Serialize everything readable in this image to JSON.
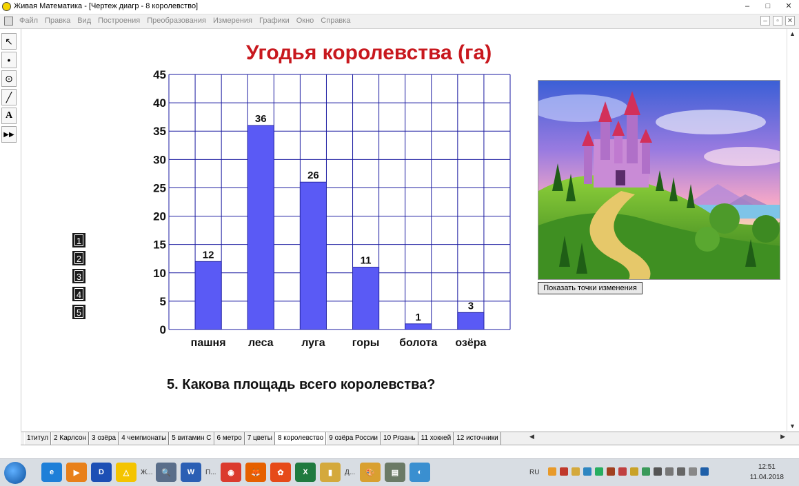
{
  "window": {
    "title": "Живая Математика - [Чертеж диагр - 8 королевство]",
    "controls": [
      "–",
      "□",
      "✕"
    ]
  },
  "menu": {
    "items": [
      "Файл",
      "Правка",
      "Вид",
      "Построения",
      "Преобразования",
      "Измерения",
      "Графики",
      "Окно",
      "Справка"
    ],
    "mdi_controls": [
      "–",
      "▫",
      "✕"
    ]
  },
  "toolbar": {
    "tools": [
      {
        "name": "arrow-tool-icon",
        "glyph": "↖"
      },
      {
        "name": "point-tool-icon",
        "glyph": "•"
      },
      {
        "name": "compass-tool-icon",
        "glyph": "⊙"
      },
      {
        "name": "line-tool-icon",
        "glyph": "╱"
      },
      {
        "name": "text-tool-icon",
        "glyph": "A"
      },
      {
        "name": "custom-tool-icon",
        "glyph": "▶▶"
      }
    ]
  },
  "document": {
    "nav_buttons": [
      "1",
      "2",
      "3",
      "4",
      "5"
    ],
    "question": "5. Какова площадь всего королевства?",
    "show_button_label": "Показать точки изменения"
  },
  "chart_data": {
    "type": "bar",
    "title": "Угодья королевства (га)",
    "categories": [
      "пашня",
      "леса",
      "луга",
      "горы",
      "болота",
      "озёра"
    ],
    "values": [
      12,
      36,
      26,
      11,
      1,
      3
    ],
    "ylim": [
      0,
      45
    ],
    "yticks": [
      0,
      5,
      10,
      15,
      20,
      25,
      30,
      35,
      40,
      45
    ],
    "xlabel": "",
    "ylabel": "",
    "grid": true,
    "colors": {
      "bar": "#5a5af5",
      "grid": "#1a1aa0",
      "title": "#c8181e"
    }
  },
  "pages": {
    "tabs": [
      "1титул",
      "2 Карлсон",
      "3 озёра",
      "4 чемпионаты",
      "5 витамин С",
      "6 метро",
      "7 цветы",
      "8 королевство",
      "9 озёра России",
      "10 Рязань",
      "11 хоккей",
      "12 источники"
    ],
    "active_index": 7
  },
  "taskbar": {
    "apps": [
      {
        "name": "ie-taskbar-icon",
        "color": "#1e7fd8",
        "label": "e"
      },
      {
        "name": "media-taskbar-icon",
        "color": "#e8801a",
        "label": "▶"
      },
      {
        "name": "d-app-taskbar-icon",
        "color": "#1c4fb5",
        "label": "D"
      },
      {
        "name": "sketchpad-taskbar-icon",
        "color": "#f4c400",
        "label": "△",
        "text": "Ж..."
      },
      {
        "name": "magnifier-taskbar-icon",
        "color": "#5a6e8a",
        "label": "🔍"
      },
      {
        "name": "word-taskbar-icon",
        "color": "#2b5fb4",
        "label": "W",
        "text": "П..."
      },
      {
        "name": "chrome-taskbar-icon",
        "color": "#db3b2e",
        "label": "◉"
      },
      {
        "name": "firefox-taskbar-icon",
        "color": "#e66000",
        "label": "🦊"
      },
      {
        "name": "reel-taskbar-icon",
        "color": "#e64a19",
        "label": "✿"
      },
      {
        "name": "excel-taskbar-icon",
        "color": "#1f7a3f",
        "label": "X"
      },
      {
        "name": "folder-taskbar-icon",
        "color": "#d4a93c",
        "label": "▮",
        "text": "Д..."
      },
      {
        "name": "paint-taskbar-icon",
        "color": "#d9a030",
        "label": "🎨"
      },
      {
        "name": "scanner-taskbar-icon",
        "color": "#6b7a66",
        "label": "▤"
      },
      {
        "name": "network-taskbar-icon",
        "color": "#3a8fd0",
        "label": "◐"
      }
    ],
    "lang": "RU",
    "time": "12:51",
    "date": "11.04.2018"
  }
}
